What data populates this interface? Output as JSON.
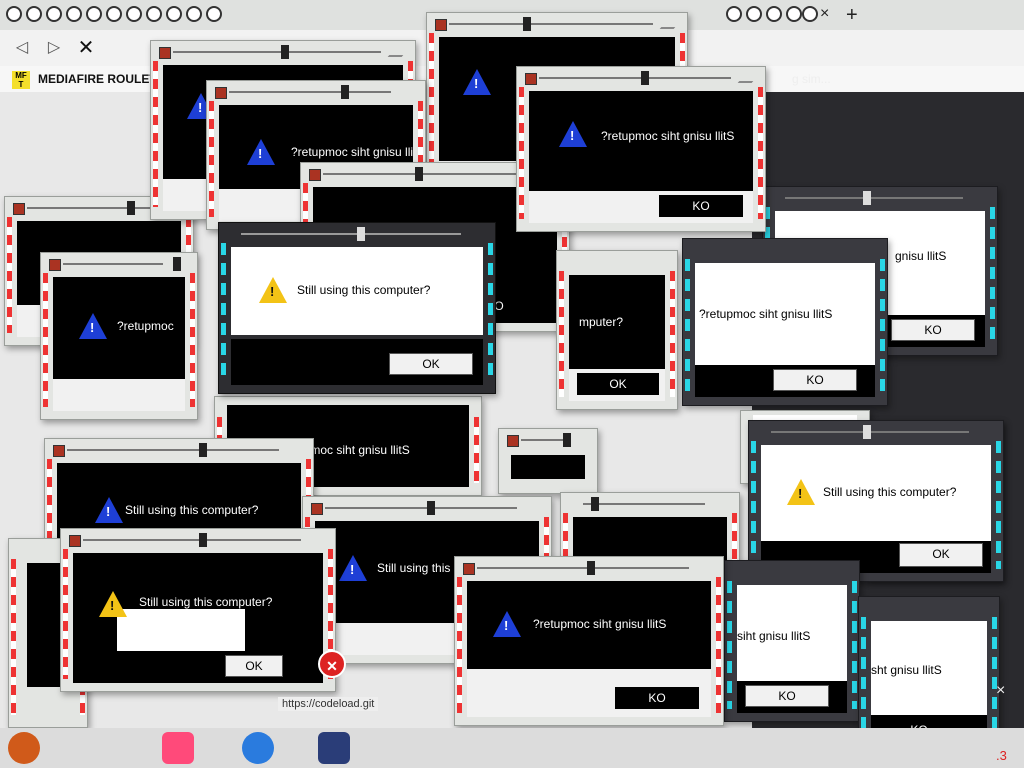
{
  "browser": {
    "bookmark_icon_text": "MF T",
    "bookmark_label": "MEDIAFIRE ROULET",
    "new_tab": "+",
    "close_tab": "×",
    "menu": "☰",
    "side_close": "×",
    "page_title_snippet": "g sim...",
    "status_url": "https://codeload.git",
    "page_counter": ".3"
  },
  "dialogs": [
    {
      "message": "Still using this computer?",
      "button": "OK"
    },
    {
      "message": "?retupmoc siht gnisu llitS",
      "button": "KO"
    },
    {
      "message": "?retupmoc siht gnisu llitS",
      "button": "KO"
    },
    {
      "message": "?retupmoc",
      "button": "KO"
    },
    {
      "message": "?retupmoc siht gnisu llitS",
      "button": "KO"
    },
    {
      "message": "Still using this computer?",
      "button": "OK"
    },
    {
      "message": "Still using this computer?",
      "button": "OK"
    },
    {
      "message": "Still using this",
      "button": "OK"
    },
    {
      "message": "upmoc siht gnisu llitS",
      "button": "KO"
    },
    {
      "message": "?retupmoc siht gnisu llitS",
      "button": "KO"
    },
    {
      "message": "siht gnisu llitS",
      "button": "KO"
    },
    {
      "message": "gnisu llitS",
      "button": "KO"
    },
    {
      "message": "Still using this computer?",
      "button": "OK"
    },
    {
      "message": "mputer?",
      "button": "OK"
    },
    {
      "message": "?retupmoc siht gnisu llitS",
      "button": "KO"
    },
    {
      "message": "sht gnisu llitS",
      "button": "KO"
    }
  ],
  "icons": {
    "warning_yellow": "warning-triangle-yellow",
    "warning_blue": "warning-triangle-blue",
    "error": "error-x-icon"
  },
  "colors": {
    "stripe_red": "#e33",
    "stripe_cyan": "#29d6e6",
    "warn_blue": "#1e3fd6",
    "warn_yellow": "#f3c316"
  }
}
